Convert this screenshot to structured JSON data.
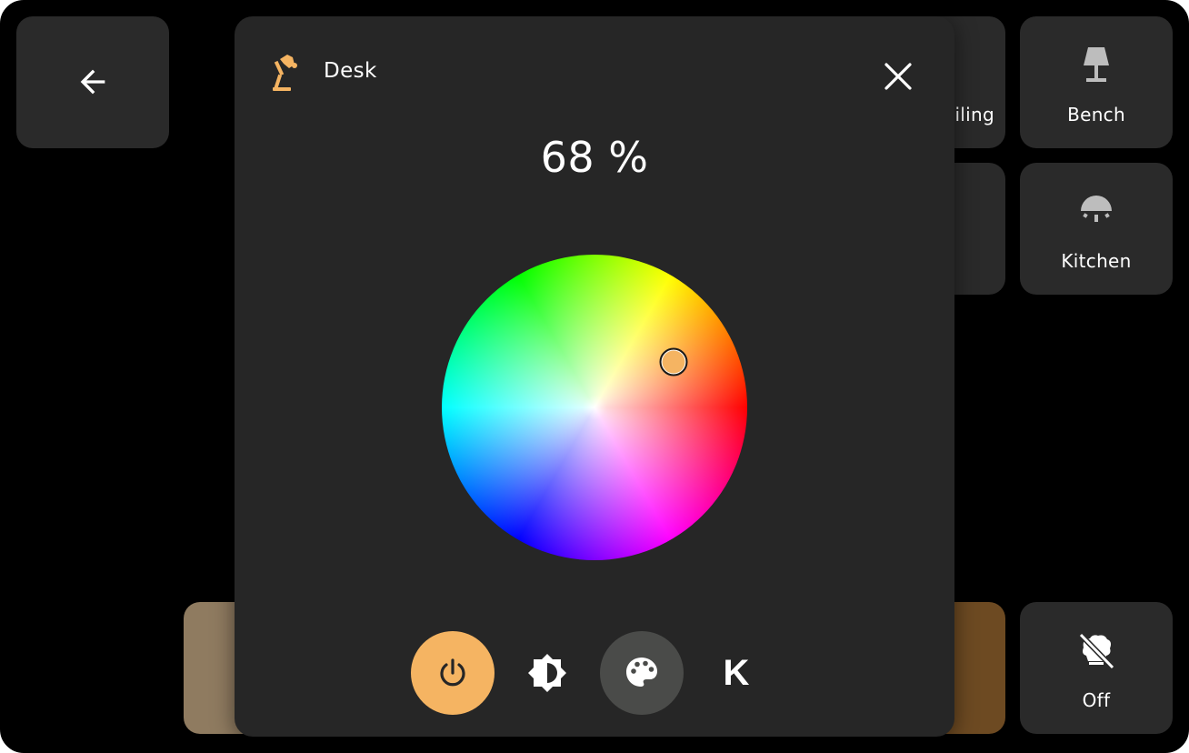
{
  "back": {
    "icon": "arrow-left-icon"
  },
  "tiles": {
    "ceiling": {
      "label": "Ceiling",
      "visible_label": "iling"
    },
    "bench": {
      "label": "Bench",
      "icon": "floor-lamp-icon"
    },
    "kitchen": {
      "label": "Kitchen",
      "icon": "ceiling-light-icon"
    },
    "off": {
      "label": "Off",
      "icon": "lights-off-icon"
    }
  },
  "dialog": {
    "title": "Desk",
    "icon": "desk-lamp-icon",
    "icon_color": "#f5b462",
    "brightness_text": "68 %",
    "brightness": 68,
    "selected_color": "#f5b462",
    "selected_hue_deg": 30,
    "selected_saturation": 0.6,
    "modes": [
      {
        "name": "power",
        "icon": "power-icon",
        "active": true,
        "color": "#f5b462"
      },
      {
        "name": "brightness",
        "icon": "brightness-icon",
        "active": false
      },
      {
        "name": "color",
        "icon": "palette-icon",
        "active": true
      },
      {
        "name": "temperature",
        "label": "K",
        "active": false
      }
    ]
  }
}
